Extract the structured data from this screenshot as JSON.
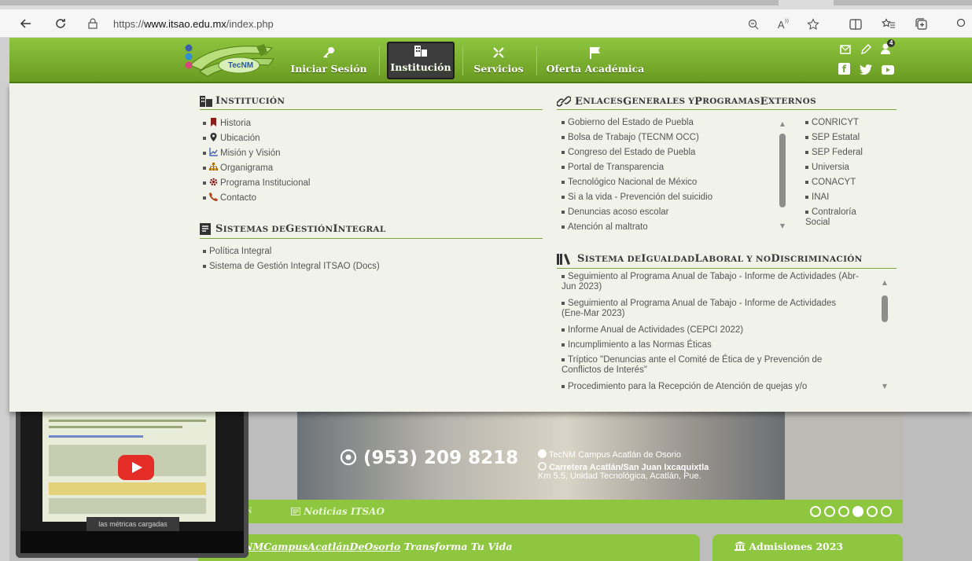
{
  "browser": {
    "url_prefix": "https://",
    "url_host": "www.itsao.edu.mx",
    "url_path": "/index.php"
  },
  "header": {
    "logo_text": "TecNM",
    "nav": [
      {
        "label": "Iniciar Sesión",
        "icon": "key-icon"
      },
      {
        "label": "Institución",
        "icon": "building-icon"
      },
      {
        "label": "Servicios",
        "icon": "tools-icon"
      },
      {
        "label": "Oferta Académica",
        "icon": "flag-icon"
      }
    ],
    "notification_count": "4"
  },
  "menu": {
    "institucion": {
      "title_first": "I",
      "title_rest": "NSTITUCIÓN",
      "items": [
        {
          "label": "Historia",
          "icon": "bookmark-icon"
        },
        {
          "label": "Ubicación",
          "icon": "map-marker-icon"
        },
        {
          "label": "Misión y Visión",
          "icon": "chart-icon"
        },
        {
          "label": "Organigrama",
          "icon": "sitemap-icon"
        },
        {
          "label": "Programa Institucional",
          "icon": "cog-icon"
        },
        {
          "label": "Contacto",
          "icon": "phone-icon"
        }
      ]
    },
    "sgi": {
      "title_parts": [
        "S",
        "ISTEMAS DE ",
        "G",
        "ESTIÓN ",
        "I",
        "NTEGRAL"
      ],
      "items": [
        "Política Integral",
        "Sistema de Gestión Integral ITSAO (Docs)"
      ]
    },
    "enlaces": {
      "title_parts": [
        "E",
        "NLACES ",
        "G",
        "ENERALES Y ",
        "P",
        "ROGRAMAS ",
        "E",
        "XTERNOS"
      ],
      "left": [
        "Gobierno del Estado de Puebla",
        "Bolsa de Trabajo (TECNM OCC)",
        "Congreso del Estado de Puebla",
        "Portal de Transparencia",
        "Tecnológico Nacional de México",
        "Si a la vida - Prevención del suicidio",
        "Denuncias acoso escolar",
        "Atención al maltrato"
      ],
      "right": [
        "CONRICYT",
        "SEP Estatal",
        "SEP Federal",
        "Universia",
        "CONACYT",
        "INAI",
        "Contraloría Social"
      ]
    },
    "igualdad": {
      "title_parts": [
        "S",
        "ISTEMA DE ",
        "I",
        "GUALDAD ",
        "L",
        "ABORAL Y NO ",
        "D",
        "ISCRIMINACIÓN"
      ],
      "items": [
        "Seguimiento al Programa Anual de Tabajo - Informe de Actividades (Abr-Jun 2023)",
        "Seguimiento al Programa Anual de Tabajo - Informe de Actividades (Ene-Mar 2023)",
        "Informe Anual de Actividades (CEPCI 2022)",
        "Incumplimiento a las Normas Éticas",
        "Tríptico \"Denuncias ante el Comité de Ética de y Prevención de Conflictos de Interés\"",
        "Procedimiento para la Recepción de Atención de quejas y/o"
      ]
    }
  },
  "background": {
    "phone": "(953) 209 8218",
    "facebook": "TecNM Campus Acatlán de Osorio",
    "address_line1": "Carretera Acatlán/San Juan Ixcaquixtla",
    "address_line2": "Km 5.5, Unidad Tecnológica, Acatlán, Pue.",
    "strip_left": "LÁN",
    "news_label": "Noticias ITSAO",
    "box1_title_prefix": "NMCampusAcatlánDeOsorio",
    "box1_title_rest": " Transforma Tu Vida",
    "box2_title": "Admisiones 2023",
    "video_caption": "las métricas cargadas",
    "slider_active_index": 3
  },
  "colors": {
    "green": "#8ec63f",
    "dark_green": "#4d7a12",
    "menu_bg": "#f1f2ea"
  }
}
